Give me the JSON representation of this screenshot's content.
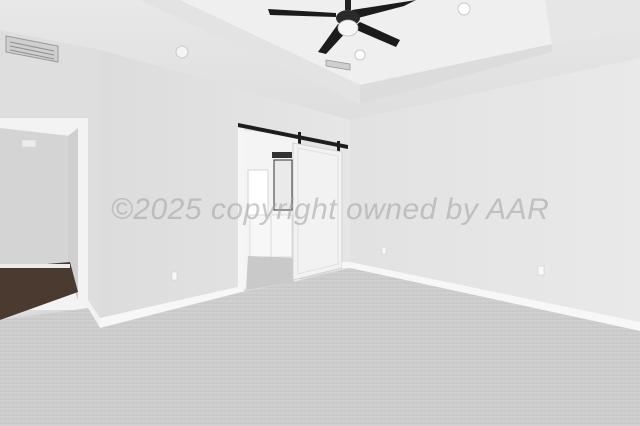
{
  "photo": {
    "description_colors": {
      "ceiling": "#ececec",
      "walls": "#e4e4e4",
      "carpet": "#cfcfcf",
      "baseboard": "#f7f7f7",
      "barn_door": "#f2f2f2",
      "rail": "#1e1e1e",
      "wood_floor": "#4b3a30"
    },
    "watermark": "©2025 copyright owned by AAR"
  }
}
